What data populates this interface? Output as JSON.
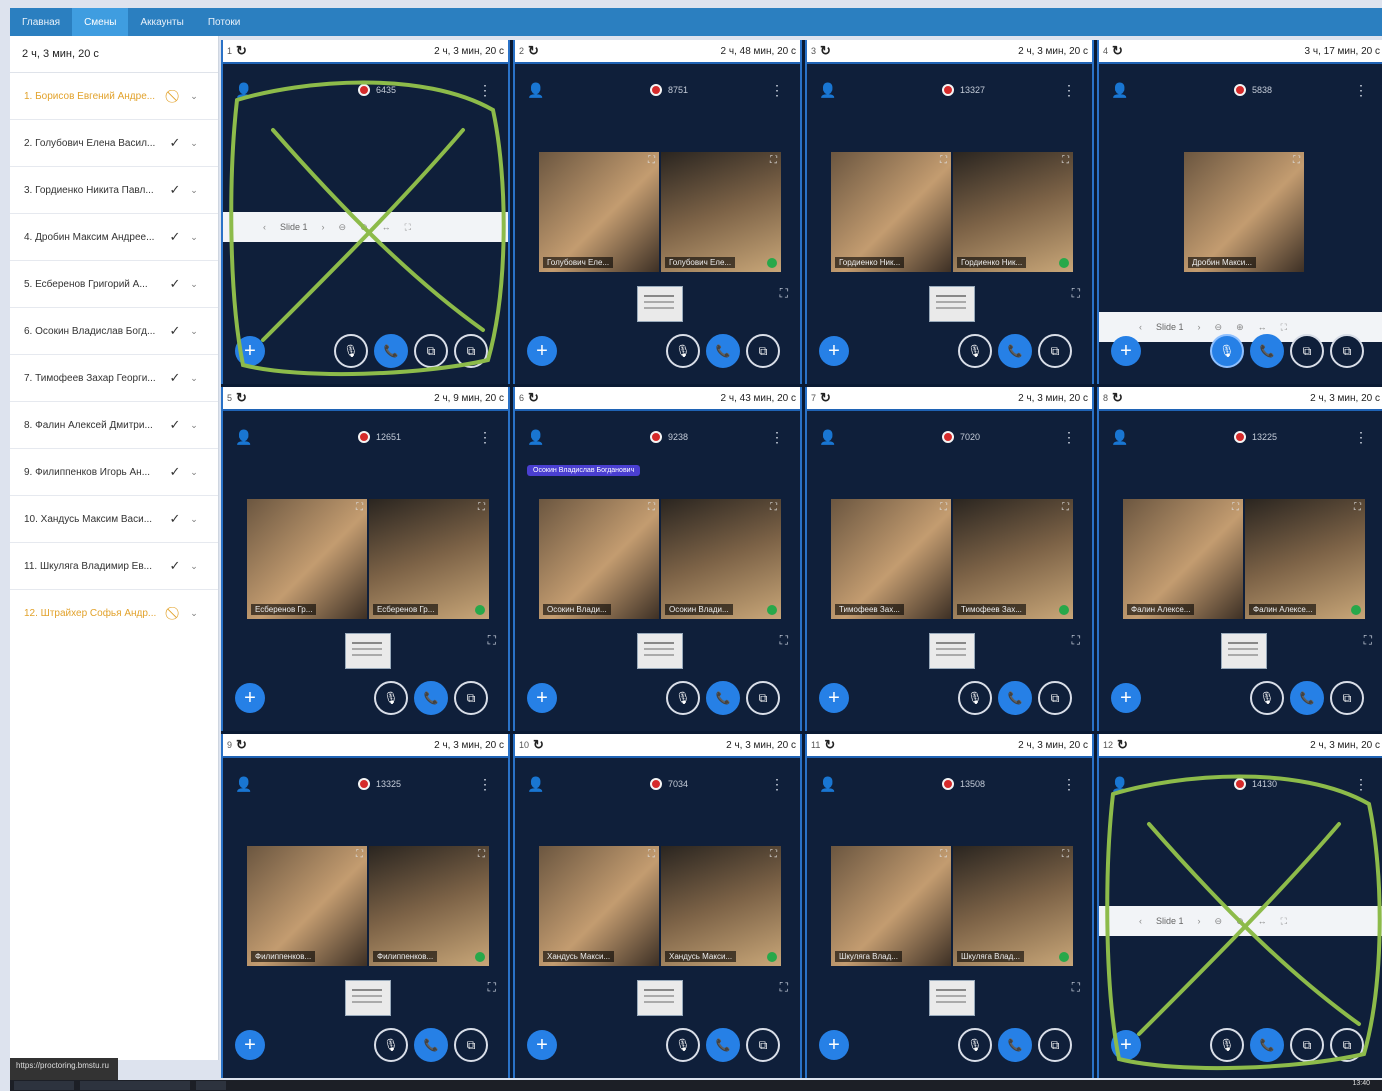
{
  "nav": {
    "tabs": [
      {
        "label": "Главная",
        "active": false
      },
      {
        "label": "Смены",
        "active": true
      },
      {
        "label": "Аккаунты",
        "active": false
      },
      {
        "label": "Потоки",
        "active": false
      }
    ]
  },
  "sidebar": {
    "timer": "2 ч, 3 мин, 20 с",
    "students": [
      {
        "label": "1. Борисов Евгений Андре...",
        "status": "warning"
      },
      {
        "label": "2. Голубович Елена Васил...",
        "status": "ok"
      },
      {
        "label": "3. Гордиенко Никита Павл...",
        "status": "ok"
      },
      {
        "label": "4. Дробин Максим Андрее...",
        "status": "ok"
      },
      {
        "label": "5. Есберенов Григорий А...",
        "status": "ok"
      },
      {
        "label": "6. Осокин Владислав Богд...",
        "status": "ok"
      },
      {
        "label": "7. Тимофеев Захар Георги...",
        "status": "ok"
      },
      {
        "label": "8. Фалин Алексей Дмитри...",
        "status": "ok"
      },
      {
        "label": "9. Филиппенков Игорь Ан...",
        "status": "ok"
      },
      {
        "label": "10. Хандусь Максим Васи...",
        "status": "ok"
      },
      {
        "label": "11. Шкуляга Владимир Ев...",
        "status": "ok"
      },
      {
        "label": "12. Штрайхер Софья Андр...",
        "status": "warning"
      }
    ],
    "status_icons": {
      "ok": "✓",
      "warning": "⃠"
    },
    "chevron": "⌄"
  },
  "panels": [
    {
      "num": "1",
      "time": "2 ч, 3 мин, 20 с",
      "rec_id": "6435",
      "videos": [],
      "slide_label": "Slide 1",
      "crossed": true
    },
    {
      "num": "2",
      "time": "2 ч, 48 мин, 20 с",
      "rec_id": "8751",
      "videos": [
        {
          "label": "Голубович Еле..."
        },
        {
          "label": "Голубович Еле..."
        }
      ],
      "crossed": false
    },
    {
      "num": "3",
      "time": "2 ч, 3 мин, 20 с",
      "rec_id": "13327",
      "videos": [
        {
          "label": "Гордиенко Ник..."
        },
        {
          "label": "Гордиенко Ник..."
        }
      ],
      "crossed": false
    },
    {
      "num": "4",
      "time": "3 ч, 17 мин, 20 с",
      "rec_id": "5838",
      "videos": [
        {
          "label": "Дробин Макси..."
        }
      ],
      "slide_label": "Slide 1",
      "crossed": false
    },
    {
      "num": "5",
      "time": "2 ч, 9 мин, 20 с",
      "rec_id": "12651",
      "videos": [
        {
          "label": "Есберенов Гр..."
        },
        {
          "label": "Есберенов Гр..."
        }
      ],
      "crossed": false
    },
    {
      "num": "6",
      "time": "2 ч, 43 мин, 20 с",
      "rec_id": "9238",
      "videos": [
        {
          "label": "Осокин Влади..."
        },
        {
          "label": "Осокин Влади..."
        }
      ],
      "name_tag": "Осокин Владислав Богданович",
      "crossed": false
    },
    {
      "num": "7",
      "time": "2 ч, 3 мин, 20 с",
      "rec_id": "7020",
      "videos": [
        {
          "label": "Тимофеев Зах..."
        },
        {
          "label": "Тимофеев Зах..."
        }
      ],
      "crossed": false
    },
    {
      "num": "8",
      "time": "2 ч, 3 мин, 20 с",
      "rec_id": "13225",
      "videos": [
        {
          "label": "Фалин Алексе..."
        },
        {
          "label": "Фалин Алексе..."
        }
      ],
      "crossed": false
    },
    {
      "num": "9",
      "time": "2 ч, 3 мин, 20 с",
      "rec_id": "13325",
      "videos": [
        {
          "label": "Филиппенков..."
        },
        {
          "label": "Филиппенков..."
        }
      ],
      "crossed": false
    },
    {
      "num": "10",
      "time": "2 ч, 3 мин, 20 с",
      "rec_id": "7034",
      "videos": [
        {
          "label": "Хандусь Макси..."
        },
        {
          "label": "Хандусь Макси..."
        }
      ],
      "crossed": false
    },
    {
      "num": "11",
      "time": "2 ч, 3 мин, 20 с",
      "rec_id": "13508",
      "videos": [
        {
          "label": "Шкуляга Влад..."
        },
        {
          "label": "Шкуляга Влад..."
        }
      ],
      "crossed": false
    },
    {
      "num": "12",
      "time": "2 ч, 3 мин, 20 с",
      "rec_id": "14130",
      "videos": [],
      "slide_label": "Slide 1",
      "crossed": true
    }
  ],
  "icons": {
    "refresh": "↻",
    "user": "👤",
    "kebab": "⋮",
    "add": "+",
    "expand": "⛶",
    "mic": "🎙",
    "phone": "📞",
    "screen": "⧉"
  },
  "colors": {
    "accent": "#2680e6",
    "nav": "#2b7fc0",
    "panel_bg": "#0f1f3a",
    "record": "#d52a2a",
    "warning": "#e2a22b",
    "scribble": "#8dbb4a"
  },
  "tooltip": "https://proctoring.bmstu.ru",
  "taskbar": {
    "clock": "13:40"
  }
}
